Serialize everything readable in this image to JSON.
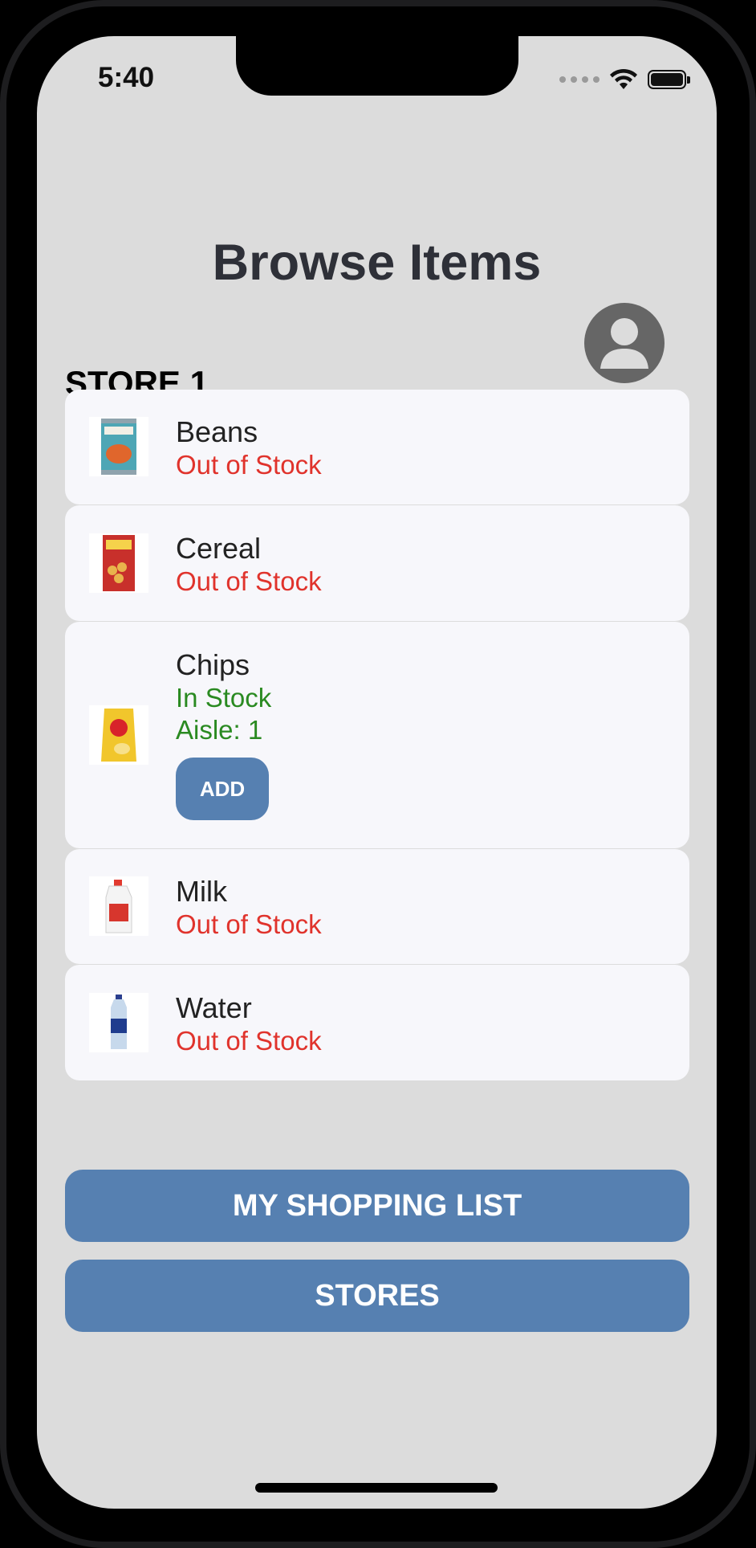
{
  "status_bar": {
    "time": "5:40"
  },
  "header": {
    "title": "Browse Items"
  },
  "store": {
    "label": "STORE 1"
  },
  "items": [
    {
      "name": "Beans",
      "status": "Out of Stock"
    },
    {
      "name": "Cereal",
      "status": "Out of Stock"
    },
    {
      "name": "Chips",
      "status": "In Stock",
      "aisle": "Aisle: 1",
      "add_label": "ADD"
    },
    {
      "name": "Milk",
      "status": "Out of Stock"
    },
    {
      "name": "Water",
      "status": "Out of Stock"
    }
  ],
  "actions": {
    "shopping_list_label": "MY SHOPPING LIST",
    "stores_label": "STORES"
  },
  "colors": {
    "accent": "#5680b1",
    "out_of_stock": "#e0332c",
    "in_stock": "#2a8a21",
    "background": "#dcdcdc"
  },
  "icons": {
    "profile": "person-circle-icon",
    "wifi": "wifi-icon",
    "battery": "battery-icon"
  }
}
